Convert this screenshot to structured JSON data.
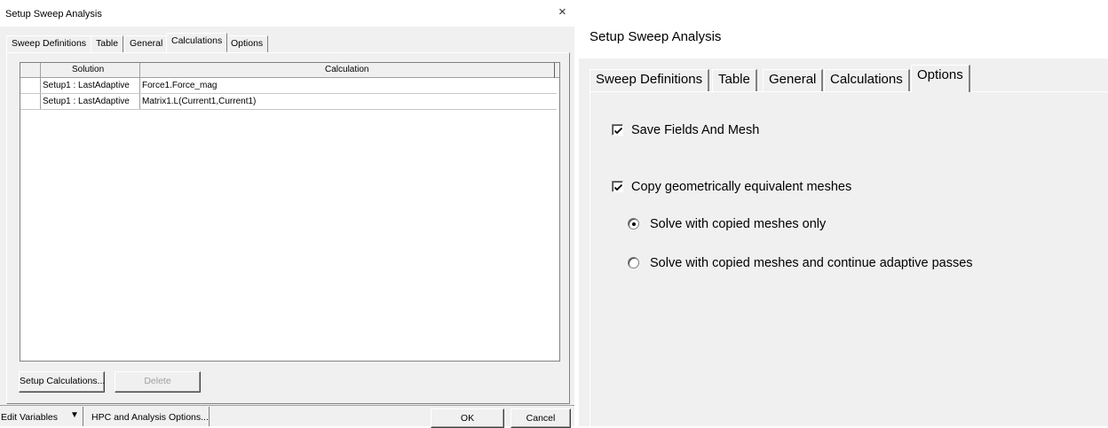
{
  "left_dialog": {
    "title": "Setup Sweep Analysis",
    "close_icon": "×",
    "tabs": [
      "Sweep Definitions",
      "Table",
      "General",
      "Calculations",
      "Options"
    ],
    "active_tab": "Calculations",
    "table": {
      "headers": [
        "Solution",
        "Calculation"
      ],
      "rows": [
        [
          "Setup1 : LastAdaptive",
          "Force1.Force_mag"
        ],
        [
          "Setup1 : LastAdaptive",
          "Matrix1.L(Current1,Current1)"
        ]
      ]
    },
    "setup_calculations_label": "Setup Calculations...",
    "delete_label": "Delete",
    "edit_variables_label": "Edit Variables",
    "dropdown_arrow": "▼",
    "hpc_label": "HPC and Analysis Options...",
    "ok_label": "OK",
    "cancel_label": "Cancel"
  },
  "right_dialog": {
    "title": "Setup Sweep Analysis",
    "tabs": [
      "Sweep Definitions",
      "Table",
      "General",
      "Calculations",
      "Options"
    ],
    "active_tab": "Options",
    "options": {
      "save_fields": {
        "label": "Save Fields And Mesh",
        "checked": true
      },
      "copy_meshes": {
        "label": "Copy geometrically equivalent meshes",
        "checked": true
      },
      "radio_copied_only": {
        "label": "Solve with copied meshes only",
        "selected": true
      },
      "radio_continue": {
        "label": "Solve with copied meshes and continue adaptive passes",
        "selected": false
      }
    }
  },
  "icons": {
    "close": "close-icon",
    "dropdown": "triangle-down-icon",
    "check": "checkmark-icon",
    "radio": "radio-dot-icon"
  }
}
